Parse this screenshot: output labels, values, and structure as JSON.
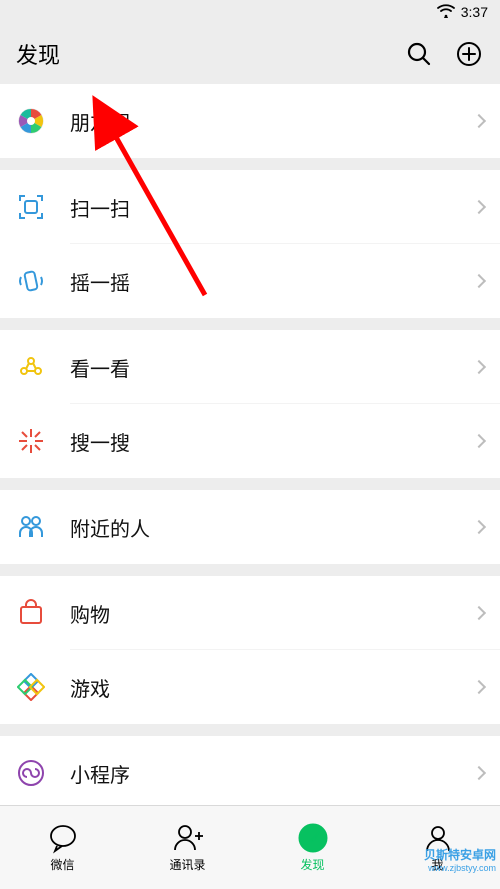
{
  "status": {
    "time": "3:37"
  },
  "header": {
    "title": "发现"
  },
  "rows": {
    "moments": "朋友圈",
    "scan": "扫一扫",
    "shake": "摇一摇",
    "topStories": "看一看",
    "search": "搜一搜",
    "nearby": "附近的人",
    "shopping": "购物",
    "games": "游戏",
    "miniPrograms": "小程序"
  },
  "tabs": {
    "chat": "微信",
    "contacts": "通讯录",
    "discover": "发现",
    "me": "我"
  },
  "watermark": {
    "line1": "贝斯特安卓网",
    "line2": "www.zjbstyy.com"
  }
}
